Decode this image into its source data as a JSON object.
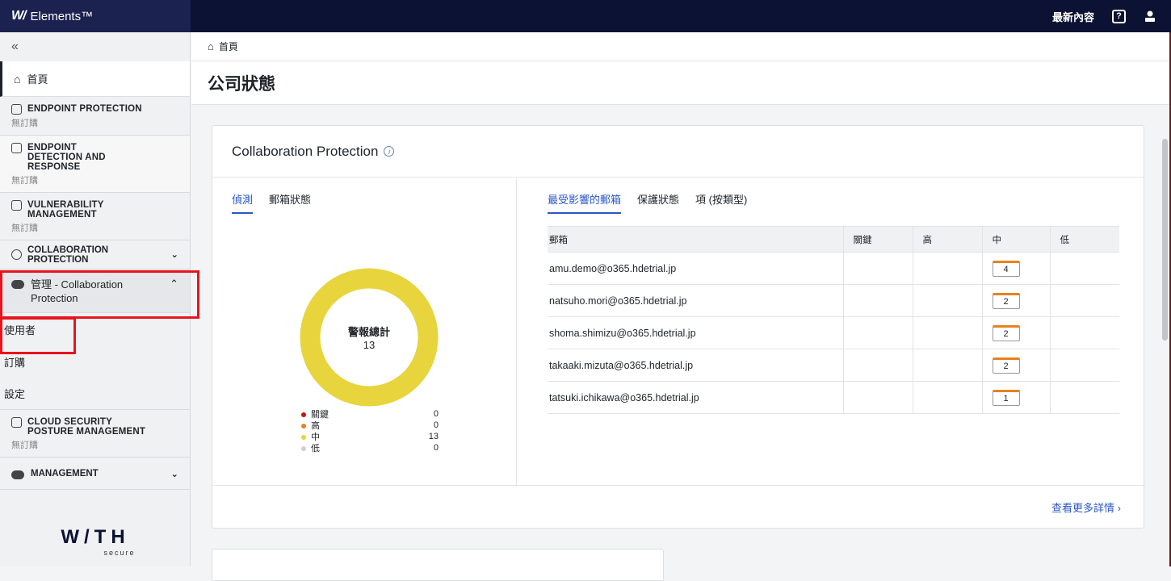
{
  "topbar": {
    "brand_mark": "W/",
    "brand_name": "Elements™",
    "whats_new": "最新內容",
    "help_icon": "help-icon",
    "user_icon": "user-icon"
  },
  "sidebar": {
    "collapse": "«",
    "home": "首頁",
    "sections": [
      {
        "title": "ENDPOINT PROTECTION",
        "sub": "無訂購"
      },
      {
        "title": "ENDPOINT DETECTION AND RESPONSE",
        "sub": "無訂購"
      },
      {
        "title": "VULNERABILITY MANAGEMENT",
        "sub": "無訂購"
      }
    ],
    "collab": "COLLABORATION PROTECTION",
    "admin": "管理 - Collaboration Protection",
    "sub_items": [
      "使用者",
      "訂購",
      "設定"
    ],
    "cspm": {
      "title": "CLOUD SECURITY POSTURE MANAGEMENT",
      "sub": "無訂購"
    },
    "management": "MANAGEMENT",
    "logo": "W/TH",
    "logo_sub": "secure"
  },
  "breadcrumb": "首頁",
  "page_title": "公司狀態",
  "card": {
    "title": "Collaboration Protection",
    "left_tabs": [
      "偵測",
      "郵箱狀態"
    ],
    "right_tabs": [
      "最受影響的郵箱",
      "保護狀態",
      "項 (按類型)"
    ],
    "donut_label": "警報總計",
    "donut_total": "13",
    "legend": [
      {
        "label": "關鍵",
        "value": "0",
        "color": "#c0141c"
      },
      {
        "label": "高",
        "value": "0",
        "color": "#e8811e"
      },
      {
        "label": "中",
        "value": "13",
        "color": "#e8d43c"
      },
      {
        "label": "低",
        "value": "0",
        "color": "#d0d0d0"
      }
    ],
    "table": {
      "headers": [
        "郵箱",
        "關鍵",
        "高",
        "中",
        "低"
      ],
      "rows": [
        {
          "mailbox": "amu.demo@o365.hdetrial.jp",
          "medium": "4"
        },
        {
          "mailbox": "natsuho.mori@o365.hdetrial.jp",
          "medium": "2"
        },
        {
          "mailbox": "shoma.shimizu@o365.hdetrial.jp",
          "medium": "2"
        },
        {
          "mailbox": "takaaki.mizuta@o365.hdetrial.jp",
          "medium": "2"
        },
        {
          "mailbox": "tatsuki.ichikawa@o365.hdetrial.jp",
          "medium": "1"
        }
      ]
    },
    "more": "查看更多詳情 ›"
  }
}
